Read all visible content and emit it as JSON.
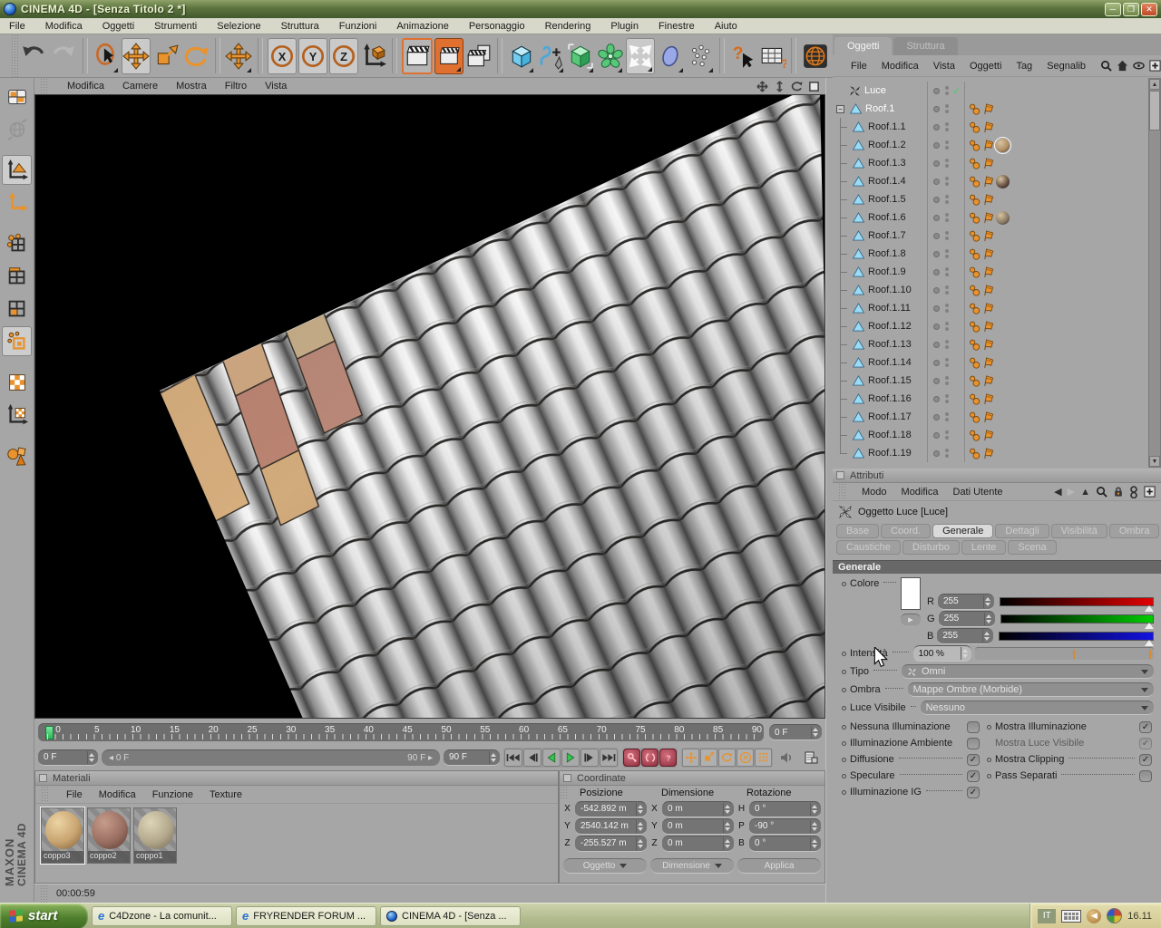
{
  "colors": {
    "accent": "#e8932e",
    "tree_blue": "#9adcf5",
    "check_green": "#4ecb6e",
    "play_green": "#35c34f",
    "record_red": "#c25060",
    "slider_red": "#e00000",
    "slider_green": "#00cc00",
    "slider_blue": "#1212e0"
  },
  "window": {
    "title": "CINEMA 4D - [Senza Titolo 2 *]"
  },
  "menu_bar": [
    "File",
    "Modifica",
    "Oggetti",
    "Strumenti",
    "Selezione",
    "Struttura",
    "Funzioni",
    "Animazione",
    "Personaggio",
    "Rendering",
    "Plugin",
    "Finestre",
    "Aiuto"
  ],
  "toolbar": {
    "items": [
      {
        "icon": "undo"
      },
      {
        "icon": "redo",
        "state": "disabled"
      },
      {
        "sep": true
      },
      {
        "icon": "live-selection",
        "flyout": true
      },
      {
        "icon": "move",
        "state": "active"
      },
      {
        "icon": "scale"
      },
      {
        "icon": "rotate"
      },
      {
        "sep": true
      },
      {
        "icon": "axis-move",
        "flyout": true
      },
      {
        "sep": true
      },
      {
        "icon": "lock-x",
        "state": "active"
      },
      {
        "icon": "lock-y",
        "state": "active"
      },
      {
        "icon": "lock-z",
        "state": "active"
      },
      {
        "icon": "coordinate-system"
      },
      {
        "sep": true
      },
      {
        "icon": "render-view",
        "state": "framed"
      },
      {
        "icon": "render-active",
        "state": "orangebg",
        "flyout": true
      },
      {
        "icon": "render-settings"
      },
      {
        "sep": true
      },
      {
        "icon": "add-primitive",
        "flyout": true
      },
      {
        "icon": "add-spline",
        "flyout": true
      },
      {
        "icon": "add-hypernurbs",
        "flyout": true
      },
      {
        "icon": "add-array",
        "flyout": true
      },
      {
        "icon": "add-deformer",
        "state": "active",
        "flyout": true
      },
      {
        "icon": "add-environment",
        "flyout": true
      },
      {
        "icon": "add-particles",
        "flyout": true
      },
      {
        "sep": true
      },
      {
        "icon": "help"
      },
      {
        "icon": "xpresso-browser"
      },
      {
        "sep": true
      },
      {
        "icon": "online-globe"
      }
    ]
  },
  "left_toolbar": [
    {
      "icon": "make-editable"
    },
    {
      "icon": "world-coordinates",
      "state": "disabled",
      "gap": true
    },
    {
      "icon": "model-mode",
      "state": "active"
    },
    {
      "icon": "object-axis-mode",
      "gap": true
    },
    {
      "icon": "point-mode"
    },
    {
      "icon": "edge-mode"
    },
    {
      "icon": "polygon-mode"
    },
    {
      "icon": "uv-mode",
      "state": "active",
      "gap": true
    },
    {
      "icon": "texture-mode"
    },
    {
      "icon": "texture-axis-mode",
      "gap": true
    },
    {
      "icon": "animation-mode"
    }
  ],
  "viewport": {
    "menu": [
      "Modifica",
      "Camere",
      "Mostra",
      "Filtro",
      "Vista"
    ],
    "corner_icons": [
      "pan-icon",
      "zoom-icon",
      "orbit-icon",
      "maximize-icon"
    ]
  },
  "timeline": {
    "ticks": [
      "0",
      "5",
      "10",
      "15",
      "20",
      "25",
      "30",
      "35",
      "40",
      "45",
      "50",
      "55",
      "60",
      "65",
      "70",
      "75",
      "80",
      "85",
      "90"
    ],
    "current_frame": "0 F",
    "range_start": "0 F",
    "range_end": "90 F",
    "end_frame": "90 F"
  },
  "object_manager": {
    "tabs": [
      {
        "label": "Oggetti",
        "active": true
      },
      {
        "label": "Struttura",
        "active": false
      }
    ],
    "menu": [
      "File",
      "Modifica",
      "Vista",
      "Oggetti",
      "Tag",
      "Segnalib"
    ],
    "tree": [
      {
        "name": "Luce",
        "type": "light",
        "selected": true,
        "check": true
      },
      {
        "name": "Roof.1",
        "type": "poly",
        "root": true,
        "selected": true
      },
      {
        "name": "Roof.1.1",
        "type": "poly"
      },
      {
        "name": "Roof.1.2",
        "type": "poly",
        "material": "#b08d62",
        "material_selected": true
      },
      {
        "name": "Roof.1.3",
        "type": "poly"
      },
      {
        "name": "Roof.1.4",
        "type": "poly",
        "material": "#5f4a3e"
      },
      {
        "name": "Roof.1.5",
        "type": "poly"
      },
      {
        "name": "Roof.1.6",
        "type": "poly",
        "material": "#857663"
      },
      {
        "name": "Roof.1.7",
        "type": "poly"
      },
      {
        "name": "Roof.1.8",
        "type": "poly"
      },
      {
        "name": "Roof.1.9",
        "type": "poly"
      },
      {
        "name": "Roof.1.10",
        "type": "poly"
      },
      {
        "name": "Roof.1.11",
        "type": "poly"
      },
      {
        "name": "Roof.1.12",
        "type": "poly"
      },
      {
        "name": "Roof.1.13",
        "type": "poly"
      },
      {
        "name": "Roof.1.14",
        "type": "poly"
      },
      {
        "name": "Roof.1.15",
        "type": "poly"
      },
      {
        "name": "Roof.1.16",
        "type": "poly"
      },
      {
        "name": "Roof.1.17",
        "type": "poly"
      },
      {
        "name": "Roof.1.18",
        "type": "poly"
      },
      {
        "name": "Roof.1.19",
        "type": "poly"
      }
    ]
  },
  "attributes": {
    "panel_title": "Attributi",
    "menu": [
      "Modo",
      "Modifica",
      "Dati Utente"
    ],
    "object_title": "Oggetto Luce [Luce]",
    "tabs": [
      [
        "Base",
        "Coord.",
        "Generale",
        "Dettagli",
        "Visibilità",
        "Ombra"
      ],
      [
        "Caustiche",
        "Disturbo",
        "Lente",
        "Scena"
      ]
    ],
    "active_tab": "Generale",
    "section_title": "Generale",
    "colore_label": "Colore",
    "rgb": [
      {
        "ch": "R",
        "value": "255"
      },
      {
        "ch": "G",
        "value": "255"
      },
      {
        "ch": "B",
        "value": "255"
      }
    ],
    "intensita_label": "Intensità",
    "intensita_value": "100 %",
    "tipo_label": "Tipo",
    "tipo_value": "Omni",
    "ombra_label": "Ombra",
    "ombra_value": "Mappe Ombre (Morbide)",
    "luce_visibile_label": "Luce Visibile",
    "luce_visibile_value": "Nessuno",
    "checks_left": [
      {
        "label": "Nessuna Illuminazione",
        "checked": false
      },
      {
        "label": "Illuminazione Ambiente",
        "checked": false
      },
      {
        "label": "Diffusione",
        "checked": true,
        "leader": true
      },
      {
        "label": "Speculare",
        "checked": true,
        "leader": true
      },
      {
        "label": "Illuminazione IG",
        "checked": true,
        "leader": true
      }
    ],
    "checks_right": [
      {
        "label": "Mostra Illuminazione",
        "checked": true
      },
      {
        "label": "Mostra Luce Visibile",
        "checked": true,
        "disabled": true,
        "bullet": false
      },
      {
        "label": "Mostra Clipping",
        "checked": true,
        "leader": true
      },
      {
        "label": "Pass Separati",
        "checked": false,
        "leader": true
      }
    ]
  },
  "materials": {
    "title": "Materiali",
    "menu": [
      "File",
      "Modifica",
      "Funzione",
      "Texture"
    ],
    "items": [
      {
        "name": "coppo3",
        "base": "#c8a470",
        "hi": "#ecd4a4",
        "lo": "#7a5c38",
        "selected": true
      },
      {
        "name": "coppo2",
        "base": "#9a6f62",
        "hi": "#c69c8c",
        "lo": "#57382f",
        "selected": false
      },
      {
        "name": "coppo1",
        "base": "#b3a88c",
        "hi": "#ddd4b8",
        "lo": "#6e6651",
        "selected": false
      }
    ]
  },
  "coordinates": {
    "title": "Coordinate",
    "headers": [
      "Posizione",
      "Dimensione",
      "Rotazione"
    ],
    "position": [
      {
        "axis": "X",
        "value": "-542.892 m"
      },
      {
        "axis": "Y",
        "value": "2540.142 m"
      },
      {
        "axis": "Z",
        "value": "-255.527 m"
      }
    ],
    "dimension": [
      {
        "axis": "X",
        "value": "0 m"
      },
      {
        "axis": "Y",
        "value": "0 m"
      },
      {
        "axis": "Z",
        "value": "0 m"
      }
    ],
    "rotation": [
      {
        "axis": "H",
        "value": "0 °"
      },
      {
        "axis": "P",
        "value": "-90 °"
      },
      {
        "axis": "B",
        "value": "0 °"
      }
    ],
    "mode_object": "Oggetto",
    "mode_size": "Dimensione",
    "apply": "Applica"
  },
  "status_bar": {
    "render_time": "00:00:59"
  },
  "brand": {
    "line1": "MAXON",
    "line2": "CINEMA 4D"
  },
  "taskbar": {
    "start_label": "start",
    "tasks": [
      {
        "label": "C4Dzone - La comunit...",
        "icon": "ie"
      },
      {
        "label": "FRYRENDER FORUM ...",
        "icon": "ie"
      },
      {
        "label": "CINEMA 4D - [Senza ...",
        "icon": "c4d"
      }
    ],
    "tray": {
      "language": "IT",
      "time": "16.11"
    }
  }
}
